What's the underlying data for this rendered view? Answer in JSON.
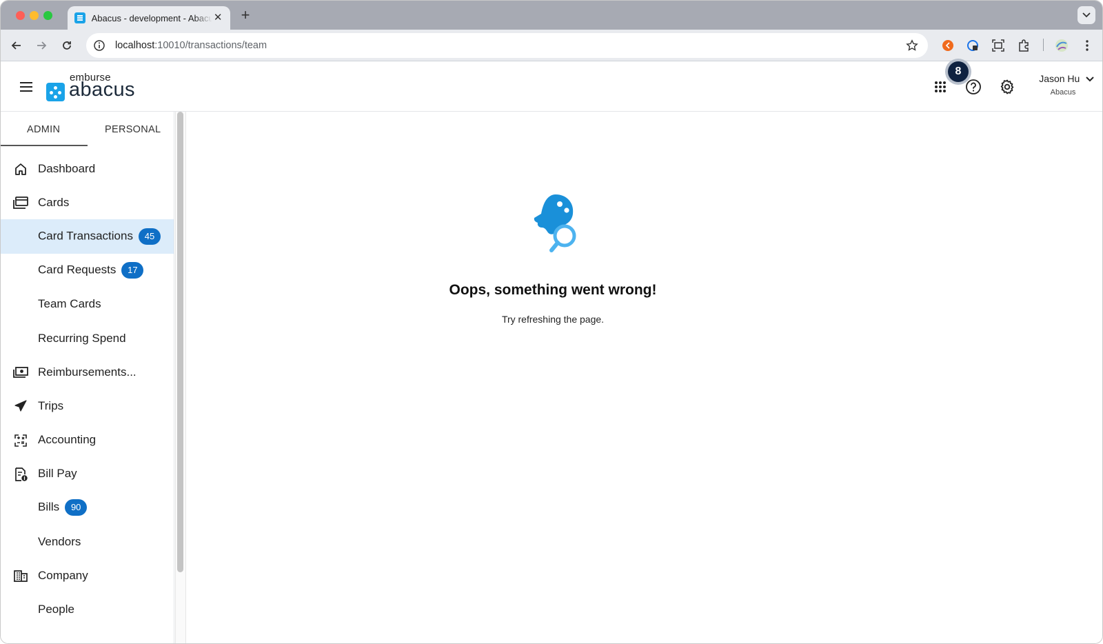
{
  "browser": {
    "tab_title": "Abacus - development - Abacus",
    "url_host": "localhost",
    "url_rest": ":10010/transactions/team"
  },
  "header": {
    "logo_top": "emburse",
    "logo_main": "abacus",
    "notification_count": "8",
    "user_name": "Jason Hu",
    "user_org": "Abacus"
  },
  "sidebar": {
    "tabs": [
      {
        "label": "ADMIN"
      },
      {
        "label": "PERSONAL"
      }
    ],
    "items": [
      {
        "label": "Dashboard",
        "icon": "home-icon"
      },
      {
        "label": "Cards",
        "icon": "cards-icon"
      },
      {
        "label": "Card Transactions",
        "count": "45"
      },
      {
        "label": "Card Requests",
        "count": "17"
      },
      {
        "label": "Team Cards"
      },
      {
        "label": "Recurring Spend"
      },
      {
        "label": "Reimbursements...",
        "icon": "cash-icon"
      },
      {
        "label": "Trips",
        "icon": "plane-icon"
      },
      {
        "label": "Accounting",
        "icon": "calculator-icon"
      },
      {
        "label": "Bill Pay",
        "icon": "bill-icon"
      },
      {
        "label": "Bills",
        "count": "90"
      },
      {
        "label": "Vendors"
      },
      {
        "label": "Company",
        "icon": "building-icon"
      },
      {
        "label": "People"
      }
    ]
  },
  "main": {
    "error_title": "Oops, something went wrong!",
    "error_subtitle": "Try refreshing the page."
  },
  "colors": {
    "accent": "#1aa3e8",
    "badge": "#0f6fc6",
    "active_bg": "#dcecfa"
  }
}
